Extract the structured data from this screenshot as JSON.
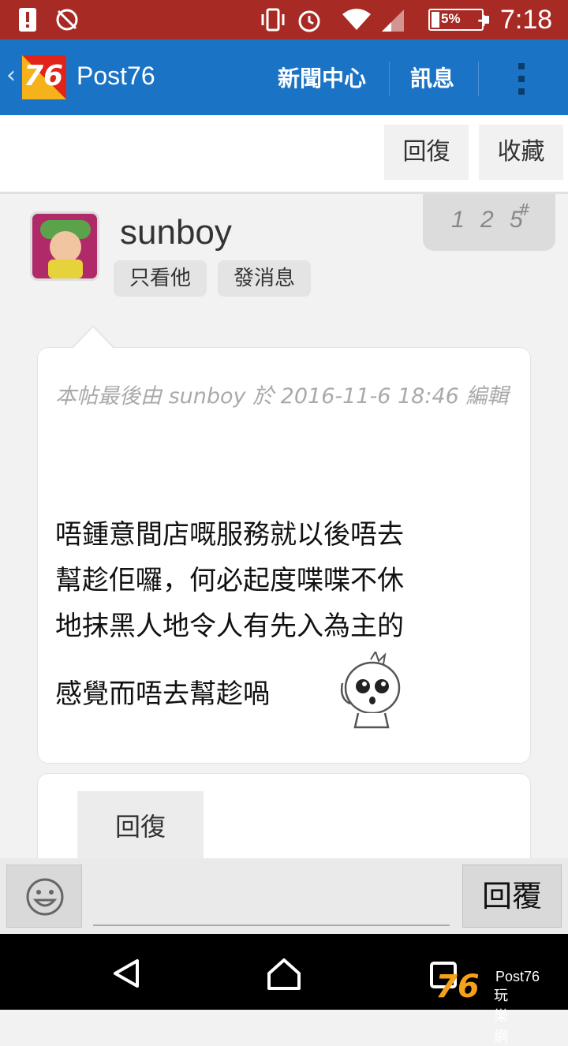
{
  "status_bar": {
    "battery_percent": "5%",
    "time": "7:18",
    "icons": [
      "alert-icon",
      "no-sync-icon",
      "vibrate-icon",
      "alarm-icon",
      "wifi-icon",
      "signal-icon",
      "battery-icon"
    ]
  },
  "app_bar": {
    "back_glyph": "‹",
    "logo_text": "76",
    "title": "Post76",
    "tabs": [
      {
        "label": "新聞中心"
      },
      {
        "label": "訊息"
      }
    ]
  },
  "action_bar": {
    "reply_label": "回復",
    "favorite_label": "收藏"
  },
  "post": {
    "username": "sunboy",
    "only_him_label": "只看他",
    "message_label": "發消息",
    "floor_number": "1 2 5",
    "floor_mark": "#",
    "edit_note": "本帖最後由 sunboy 於 2016-11-6 18:46 編輯",
    "content_lines": [
      "唔鍾意間店嘅服務就以後唔去",
      "幫趁佢囉，何必起度喋喋不休",
      "地抹黑人地令人有先入為主的",
      "感覺而唔去幫趁喎"
    ]
  },
  "quote_card": {
    "reply_label": "回復"
  },
  "input_bar": {
    "placeholder": "",
    "send_label": "回覆"
  },
  "nav_brand": {
    "logo": "76",
    "name": "Post76",
    "subtitle": "玩樂網"
  }
}
